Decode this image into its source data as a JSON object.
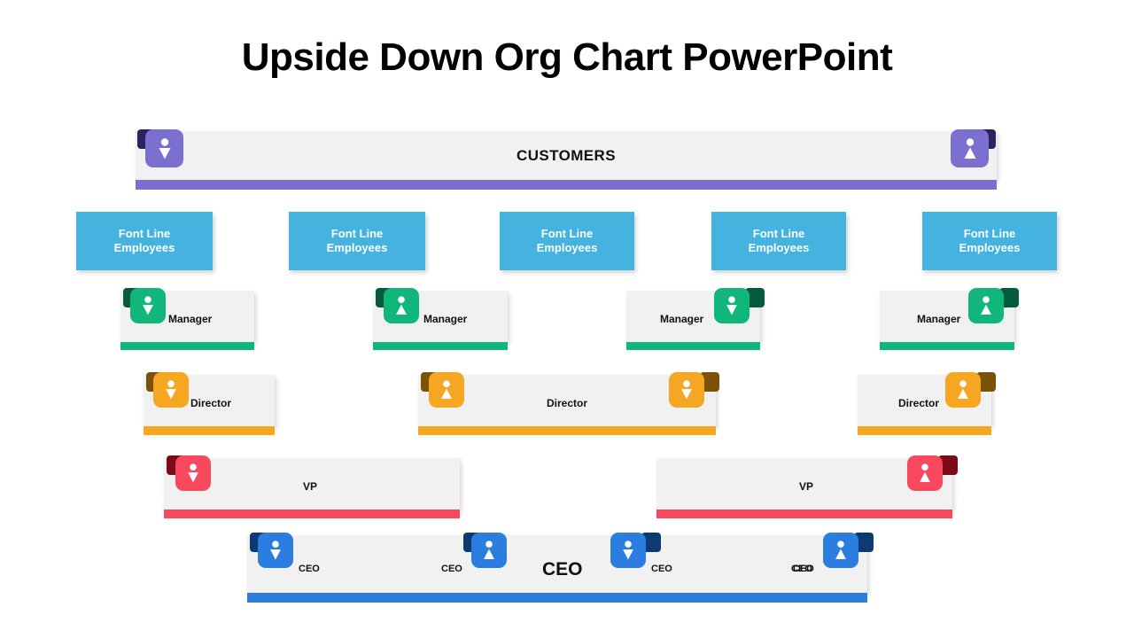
{
  "slide": {
    "title": "Upside Down Org Chart PowerPoint",
    "background": "#ffffff"
  },
  "colors": {
    "customers": "#7b6fd0",
    "customers_fold": "#2b2360",
    "front_line": "#44b3df",
    "manager": "#11b67a",
    "manager_fold": "#055c3b",
    "director": "#f5a623",
    "director_fold": "#7c5208",
    "vp": "#f8485e",
    "vp_fold": "#7d0a18",
    "ceo": "#2b7de0",
    "ceo_fold": "#0d3a73",
    "card_body": "#f1f1f1",
    "text": "#111111"
  },
  "levels": {
    "customers": {
      "label": "CUSTOMERS",
      "icons": [
        {
          "name": "person-icon-inverted",
          "orientation": "inverted"
        },
        {
          "name": "person-icon-upright",
          "orientation": "upright"
        }
      ]
    },
    "front_line": {
      "label": "Font Line\nEmployees",
      "line1": "Font Line",
      "line2": "Employees",
      "boxes": [
        {
          "label_line1": "Font Line",
          "label_line2": "Employees"
        },
        {
          "label_line1": "Font Line",
          "label_line2": "Employees"
        },
        {
          "label_line1": "Font Line",
          "label_line2": "Employees"
        },
        {
          "label_line1": "Font Line",
          "label_line2": "Employees"
        },
        {
          "label_line1": "Font Line",
          "label_line2": "Employees"
        }
      ]
    },
    "manager": {
      "cards": [
        {
          "label": "Manager",
          "icon_orientation": "inverted",
          "icon_side": "left"
        },
        {
          "label": "Manager",
          "icon_orientation": "upright",
          "icon_side": "left"
        },
        {
          "label": "Manager",
          "icon_orientation": "inverted",
          "icon_side": "right"
        },
        {
          "label": "Manager",
          "icon_orientation": "upright",
          "icon_side": "right"
        }
      ]
    },
    "director": {
      "cards": [
        {
          "label": "Director",
          "icon_orientation": "inverted",
          "icon_side": "left"
        },
        {
          "label": "Director",
          "icon_orientation": "upright",
          "icon_side": "left"
        },
        {
          "label": "Director",
          "icon_orientation": "inverted",
          "icon_side": "right"
        },
        {
          "label": "Director",
          "icon_orientation": "upright",
          "icon_side": "right"
        }
      ]
    },
    "vp": {
      "cards": [
        {
          "label": "VP",
          "icon_orientation": "inverted",
          "icon_side": "left"
        },
        {
          "label": "VP",
          "icon_orientation": "upright",
          "icon_side": "right"
        }
      ]
    },
    "ceo": {
      "card_label_large": "CEO",
      "labels": [
        "CEO",
        "CEO",
        "CEO",
        "CEO",
        "CEO"
      ],
      "icons": [
        {
          "orientation": "inverted"
        },
        {
          "orientation": "upright"
        },
        {
          "orientation": "inverted"
        },
        {
          "orientation": "upright"
        }
      ]
    }
  }
}
